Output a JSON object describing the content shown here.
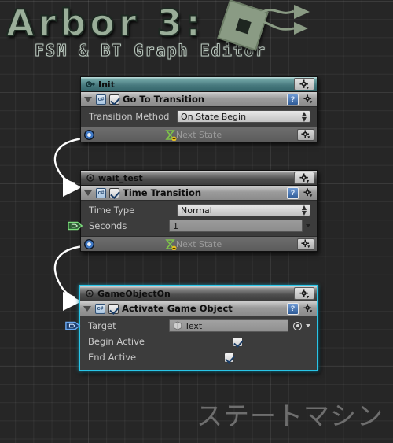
{
  "app": {
    "logo_title": "Arbor 3:",
    "logo_subtitle": "FSM & BT Graph Editor",
    "watermark": "ステートマシン",
    "accent_selected": "#29c5e8",
    "header_start_color": "#45777c",
    "header_normal_color": "#4d4d4d",
    "canvas_bg": "#262626"
  },
  "nodes": [
    {
      "id": "init",
      "title": "Init",
      "icon": "start-state-icon",
      "header_style": "teal",
      "selected": false,
      "settings_label": "",
      "component": {
        "title": "Go To Transition",
        "script_icon": "c#",
        "enabled": true,
        "help_icon": "help-book-icon",
        "gear_icon": "gear-icon"
      },
      "fields": [
        {
          "type": "dropdown",
          "label": "Transition Method",
          "value": "On State Begin"
        }
      ],
      "transition": {
        "label": "Next State",
        "icon": "hourglass-add-icon"
      }
    },
    {
      "id": "wait_test",
      "title": "wait_test",
      "icon": "state-icon",
      "header_style": "grey",
      "selected": false,
      "component": {
        "title": "Time Transition",
        "script_icon": "c#",
        "enabled": true,
        "help_icon": "help-book-icon",
        "gear_icon": "gear-icon"
      },
      "fields": [
        {
          "type": "dropdown",
          "label": "Time Type",
          "value": "Normal"
        },
        {
          "type": "text",
          "label": "Seconds",
          "value": "1",
          "port": "green"
        }
      ],
      "transition": {
        "label": "Next State",
        "icon": "hourglass-add-icon"
      }
    },
    {
      "id": "gameobjecton",
      "title": "GameObjectOn",
      "icon": "state-icon",
      "header_style": "grey",
      "selected": true,
      "component": {
        "title": "Activate Game Object",
        "script_icon": "c#",
        "enabled": true,
        "help_icon": "help-book-icon",
        "gear_icon": "gear-icon"
      },
      "fields": [
        {
          "type": "object",
          "label": "Target",
          "value": "Text",
          "port": "blue"
        },
        {
          "type": "checkbox",
          "label": "Begin Active",
          "value": true
        },
        {
          "type": "checkbox",
          "label": "End Active",
          "value": true
        }
      ]
    }
  ]
}
